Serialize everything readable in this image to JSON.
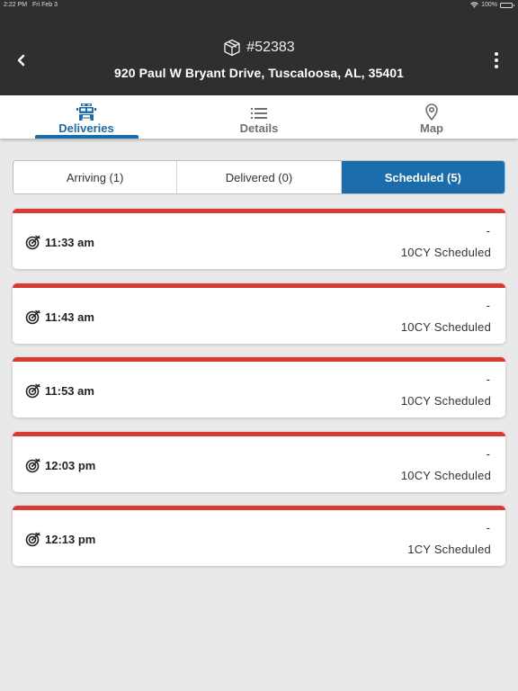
{
  "status_bar": {
    "time": "2:22 PM",
    "date": "Fri Feb 3",
    "battery": "100%"
  },
  "header": {
    "order_number": "#52383",
    "address": "920 Paul W Bryant Drive, Tuscaloosa, AL, 35401",
    "icons": {
      "back": "chevron-left-icon",
      "more": "more-vertical-icon",
      "order": "package-icon"
    }
  },
  "tabs": [
    {
      "label": "Deliveries",
      "icon": "truck-icon",
      "active": true
    },
    {
      "label": "Details",
      "icon": "list-icon",
      "active": false
    },
    {
      "label": "Map",
      "icon": "map-pin-icon",
      "active": false
    }
  ],
  "segments": [
    {
      "label": "Arriving (1)",
      "active": false
    },
    {
      "label": "Delivered (0)",
      "active": false
    },
    {
      "label": "Scheduled (5)",
      "active": true
    }
  ],
  "deliveries": [
    {
      "time": "11:33 am",
      "dash": "-",
      "status": "10CY Scheduled"
    },
    {
      "time": "11:43 am",
      "dash": "-",
      "status": "10CY Scheduled"
    },
    {
      "time": "11:53 am",
      "dash": "-",
      "status": "10CY Scheduled"
    },
    {
      "time": "12:03 pm",
      "dash": "-",
      "status": "10CY Scheduled"
    },
    {
      "time": "12:13 pm",
      "dash": "-",
      "status": "1CY Scheduled"
    }
  ],
  "colors": {
    "accent": "#1a6cab",
    "header_bg": "#2f2f31",
    "card_stripe": "#d63c2f",
    "page_bg": "#e9e9e9"
  }
}
